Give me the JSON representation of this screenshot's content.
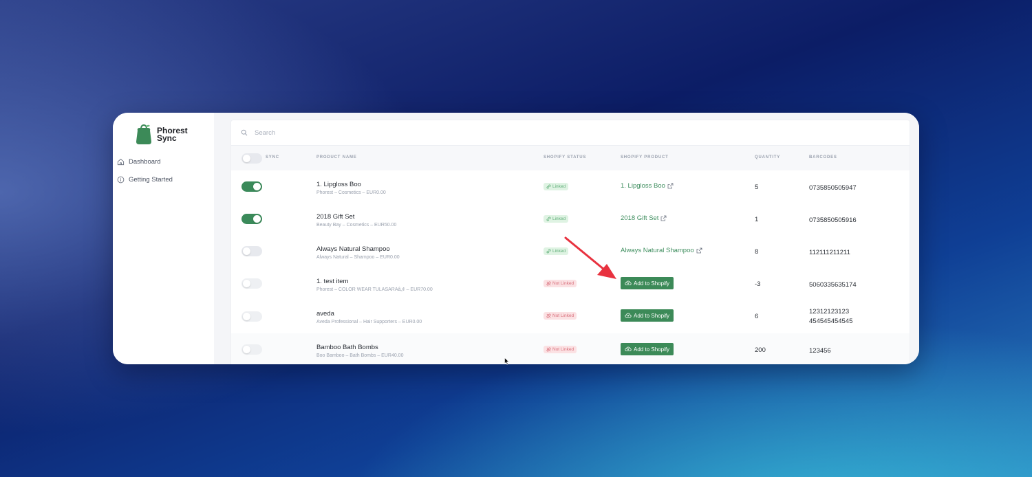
{
  "brand": {
    "name": "Phorest\nSync"
  },
  "sidebar": {
    "items": [
      {
        "label": "Dashboard",
        "icon": "home-icon"
      },
      {
        "label": "Getting Started",
        "icon": "info-icon"
      }
    ]
  },
  "search": {
    "placeholder": "Search",
    "value": ""
  },
  "table": {
    "headers": {
      "sync": "SYNC",
      "product_name": "PRODUCT NAME",
      "shopify_status": "SHOPIFY STATUS",
      "shopify_product": "SHOPIFY PRODUCT",
      "quantity": "QUANTITY",
      "barcodes": "BARCODES"
    },
    "rows": [
      {
        "sync": true,
        "name": "1. Lipgloss Boo",
        "meta": "Phorest – Cosmetics – EUR0.00",
        "status": "Linked",
        "shopify_product": "1. Lipgloss Boo",
        "quantity": "5",
        "barcodes": "0735850505947"
      },
      {
        "sync": true,
        "name": "2018 Gift Set",
        "meta": "Beauty Bay – Cosmetics – EUR50.00",
        "status": "Linked",
        "shopify_product": "2018 Gift Set",
        "quantity": "1",
        "barcodes": "0735850505916"
      },
      {
        "sync": false,
        "name": "Always Natural Shampoo",
        "meta": "Always Natural – Shampoo – EUR0.00",
        "status": "Linked",
        "shopify_product": "Always Natural Shampoo",
        "quantity": "8",
        "barcodes": "112111211211"
      },
      {
        "sync": false,
        "name": "1. test item",
        "meta": "Phorest – COLOR WEAR TULASARAâ„¢ – EUR70.00",
        "status": "Not Linked",
        "shopify_product": "Add to Shopify",
        "quantity": "-3",
        "barcodes": "5060335635174"
      },
      {
        "sync": false,
        "name": "aveda",
        "meta": "Aveda Professional – Hair Supporters – EUR0.00",
        "status": "Not Linked",
        "shopify_product": "Add to Shopify",
        "quantity": "6",
        "barcodes": "12312123123\n454545454545"
      },
      {
        "sync": false,
        "name": "Bamboo Bath Bombs",
        "meta": "Boo Bamboo – Bath Bombs – EUR40.00",
        "status": "Not Linked",
        "shopify_product": "Add to Shopify",
        "quantity": "200",
        "barcodes": "123456"
      }
    ]
  },
  "colors": {
    "accent": "#3c8a58",
    "linked_bg": "#dff3e3",
    "not_linked_bg": "#fbe1e3",
    "annotation_arrow": "#e8323f"
  }
}
